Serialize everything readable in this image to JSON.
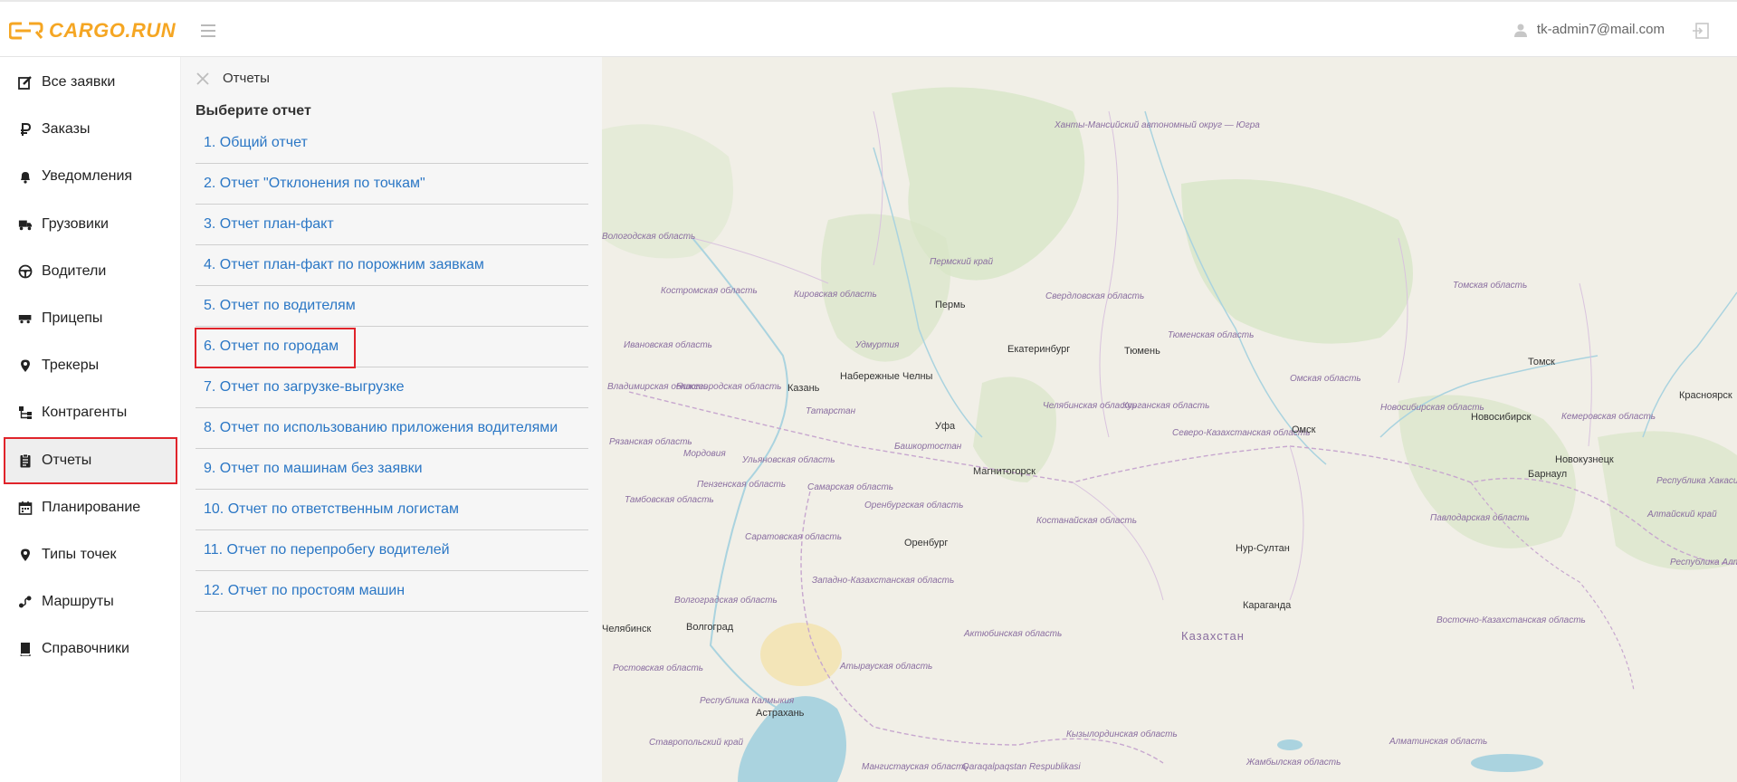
{
  "header": {
    "logo_text": "CARGO.RUN",
    "user_email": "tk-admin7@mail.com"
  },
  "sidebar": {
    "items": [
      {
        "label": "Все заявки",
        "icon": "edit-icon"
      },
      {
        "label": "Заказы",
        "icon": "ruble-icon"
      },
      {
        "label": "Уведомления",
        "icon": "bell-icon"
      },
      {
        "label": "Грузовики",
        "icon": "truck-icon"
      },
      {
        "label": "Водители",
        "icon": "steering-wheel-icon"
      },
      {
        "label": "Прицепы",
        "icon": "trailer-icon"
      },
      {
        "label": "Трекеры",
        "icon": "map-pin-icon"
      },
      {
        "label": "Контрагенты",
        "icon": "org-chart-icon"
      },
      {
        "label": "Отчеты",
        "icon": "clipboard-icon"
      },
      {
        "label": "Планирование",
        "icon": "calendar-icon"
      },
      {
        "label": "Типы точек",
        "icon": "map-pin-icon"
      },
      {
        "label": "Маршруты",
        "icon": "route-icon"
      },
      {
        "label": "Справочники",
        "icon": "book-icon"
      }
    ],
    "active_index": 8
  },
  "reports": {
    "title": "Отчеты",
    "subtitle": "Выберите отчет",
    "items": [
      "1. Общий отчет",
      "2. Отчет \"Отклонения по точкам\"",
      "3. Отчет план-факт",
      "4. Отчет план-факт по порожним заявкам",
      "5. Отчет по водителям",
      "6. Отчет по городам",
      "7. Отчет по загрузке-выгрузке",
      "8. Отчет по использованию приложения водителями",
      "9. Отчет по машинам без заявки",
      "10. Отчет по ответственным логистам",
      "11. Отчет по перепробегу водителей",
      "12. Отчет по простоям машин"
    ],
    "highlighted_index": 5
  },
  "map": {
    "cities": [
      "Пермь",
      "Екатеринбург",
      "Тюмень",
      "Томск",
      "Красноярск",
      "Казань",
      "Набережные Челны",
      "Уфа",
      "Омск",
      "Новосибирск",
      "Новокузнецк",
      "Барнаул",
      "Магнитогорск",
      "Оренбург",
      "Нур-Султан",
      "Караганда",
      "Волгоград",
      "Астрахань",
      "Челябинск"
    ],
    "country": "Казахстан",
    "regions": [
      "Ханты-Мансийский автономный округ — Югра",
      "Вологодская область",
      "Костромская область",
      "Кировская область",
      "Пермский край",
      "Свердловская область",
      "Томская область",
      "Тюменская область",
      "Ивановская область",
      "Нижегородская область",
      "Удмуртия",
      "Владимирская область",
      "Татарстан",
      "Челябинская область",
      "Курганская область",
      "Омская область",
      "Новосибирская область",
      "Кемеровская область",
      "Рязанская область",
      "Мордовия",
      "Ульяновская область",
      "Башкортостан",
      "Северо-Казахстанская область",
      "Пензенская область",
      "Самарская область",
      "Алтайский край",
      "Республика Хакасия",
      "Тамбовская область",
      "Оренбургская область",
      "Костанайская область",
      "Павлодарская область",
      "Саратовская область",
      "Республика Алтай",
      "Западно-Казахстанская область",
      "Волгоградская область",
      "Восточно-Казахстанская область",
      "Актюбинская область",
      "Атырауская область",
      "Ростовская область",
      "Республика Калмыкия",
      "Ставропольский край",
      "Мангистауская область",
      "Кызылординская область",
      "Qaraqalpaqstan Respublikasi",
      "Жамбылская область",
      "Алматинская область"
    ]
  }
}
